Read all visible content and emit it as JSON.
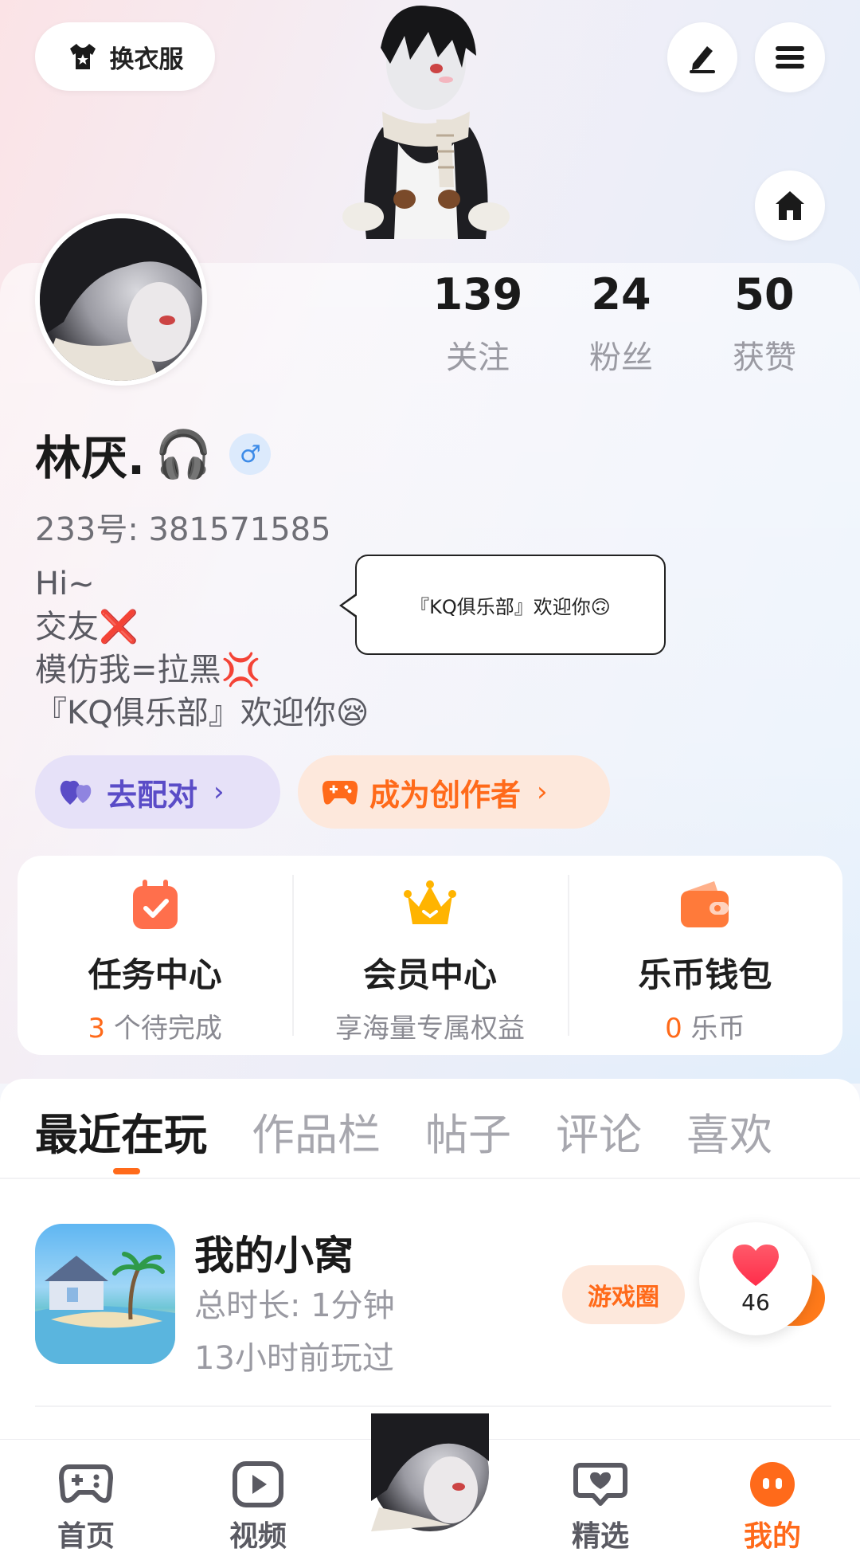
{
  "header": {
    "outfit_label": "换衣服",
    "outfit_icon": "tshirt-icon",
    "edit_icon": "pencil-icon",
    "menu_icon": "menu-icon",
    "home_icon": "home-icon"
  },
  "profile": {
    "name": "林厌.",
    "name_emoji": "🎧",
    "gender": "♂",
    "user_id": "233号: 381571585",
    "bio": [
      "Hi~",
      "交友❌",
      "模仿我=拉黑💢",
      "『KQ俱乐部』欢迎你😪"
    ],
    "speech_bubble": "『KQ俱乐部』欢迎你🙃"
  },
  "stats": [
    {
      "value": "139",
      "label": "关注"
    },
    {
      "value": "24",
      "label": "粉丝"
    },
    {
      "value": "50",
      "label": "获赞"
    }
  ],
  "actions": {
    "match_label": "去配对",
    "creator_label": "成为创作者",
    "chevron": "›"
  },
  "cards": [
    {
      "title": "任务中心",
      "sub_highlight": "3",
      "sub_text": " 个待完成",
      "icon": "calendar-check-icon"
    },
    {
      "title": "会员中心",
      "sub_highlight": "",
      "sub_text": "享海量专属权益",
      "icon": "crown-icon"
    },
    {
      "title": "乐币钱包",
      "sub_highlight": "0",
      "sub_text": " 乐币",
      "icon": "wallet-icon"
    }
  ],
  "tabs": [
    "最近在玩",
    "作品栏",
    "帖子",
    "评论",
    "喜欢"
  ],
  "active_tab": "最近在玩",
  "game": {
    "title": "我的小窝",
    "duration": "总时长: 1分钟",
    "last_played": "13小时前玩过",
    "circle_label": "游戏圈",
    "like_count": "46"
  },
  "nav": [
    {
      "label": "首页",
      "icon": "gamepad-icon"
    },
    {
      "label": "视频",
      "icon": "video-play-icon"
    },
    {
      "label": "精选",
      "icon": "heart-chat-icon"
    },
    {
      "label": "我的",
      "icon": "chat-dots-icon"
    }
  ],
  "colors": {
    "accent": "#ff6a1a",
    "match_purple": "#5a4cc7",
    "gender_blue": "#3d8be8"
  }
}
